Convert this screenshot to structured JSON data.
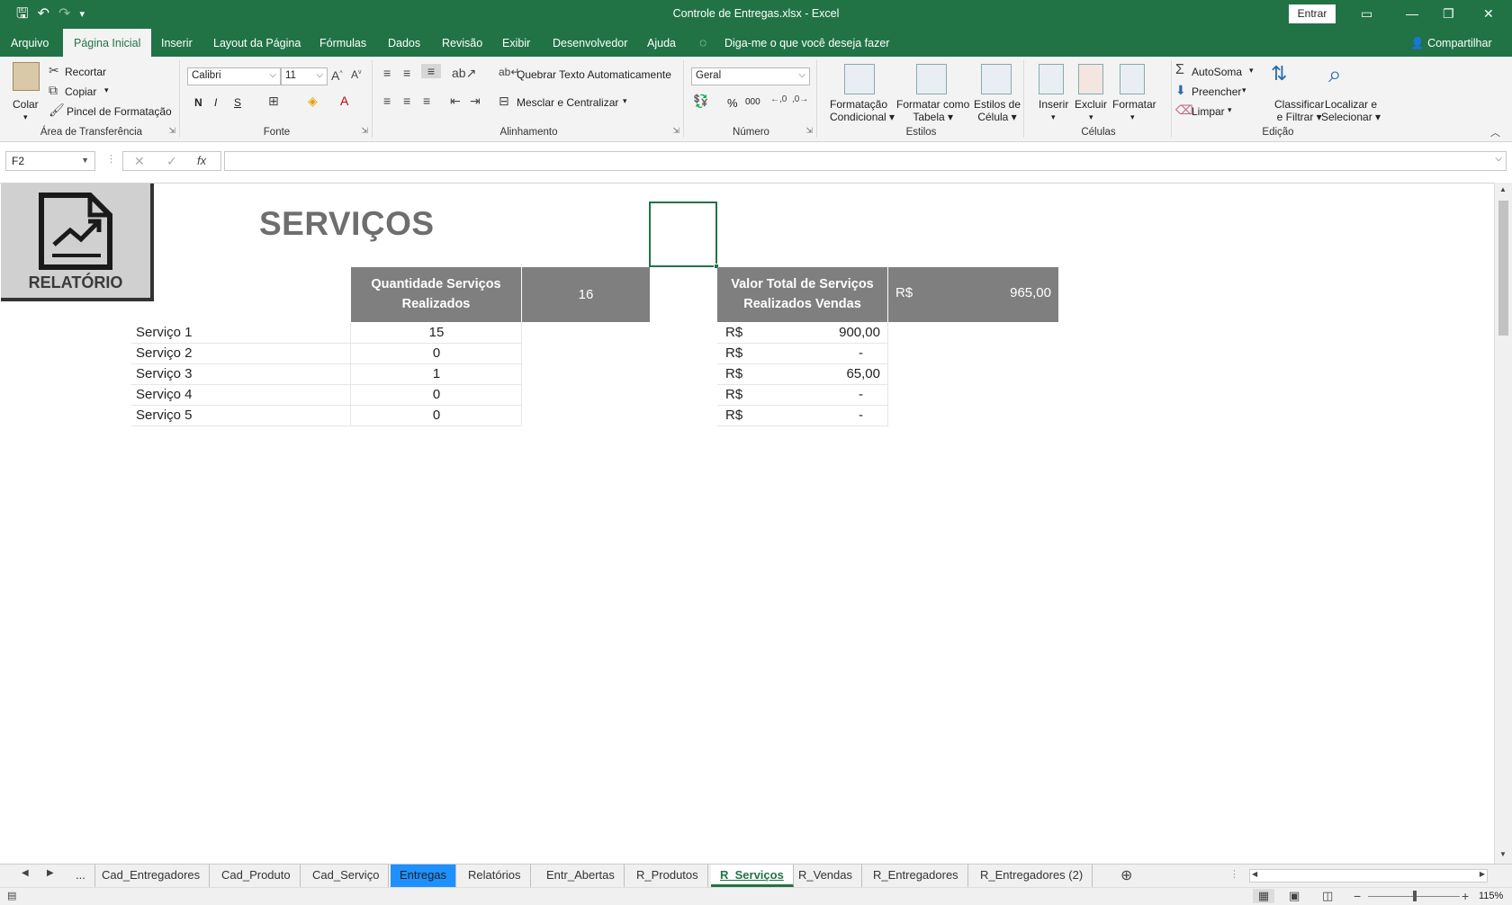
{
  "window": {
    "title": "Controle de Entregas.xlsx  -  Excel",
    "signin_label": "Entrar",
    "qat_icons": [
      "save-icon",
      "undo-icon",
      "redo-icon",
      "customize-icon"
    ]
  },
  "ribbon_tabs": [
    "Arquivo",
    "Página Inicial",
    "Inserir",
    "Layout da Página",
    "Fórmulas",
    "Dados",
    "Revisão",
    "Exibir",
    "Desenvolvedor",
    "Ajuda"
  ],
  "active_tab": "Página Inicial",
  "tell_me": "Diga-me o que você deseja fazer",
  "share_label": "Compartilhar",
  "clipboard": {
    "paste": "Colar",
    "cut": "Recortar",
    "copy": "Copiar",
    "format_painter": "Pincel de Formatação",
    "label": "Área de Transferência"
  },
  "font": {
    "name": "Calibri",
    "size": "11",
    "bold": "N",
    "italic": "I",
    "underline": "S",
    "label": "Fonte"
  },
  "alignment": {
    "wrap": "Quebrar Texto Automaticamente",
    "merge": "Mesclar e Centralizar",
    "label": "Alinhamento"
  },
  "number": {
    "format": "Geral",
    "label": "Número",
    "percent": "%",
    "thousands": "000"
  },
  "styles": {
    "conditional_1": "Formatação",
    "conditional_2": "Condicional",
    "table_1": "Formatar como",
    "table_2": "Tabela",
    "cell_1": "Estilos de",
    "cell_2": "Célula",
    "label": "Estilos"
  },
  "cells": {
    "insert": "Inserir",
    "delete": "Excluir",
    "format": "Formatar",
    "label": "Células"
  },
  "editing": {
    "autosum": "AutoSoma",
    "fill": "Preencher",
    "clear": "Limpar",
    "sort_1": "Classificar",
    "sort_2": "e Filtrar",
    "find_1": "Localizar e",
    "find_2": "Selecionar",
    "label": "Edição"
  },
  "formula_bar": {
    "name_box": "F2",
    "formula": "",
    "fx": "fx"
  },
  "sheet": {
    "logo_label": "RELATÓRIO",
    "title": "SERVIÇOS",
    "qty_header_1": "Quantidade Serviços",
    "qty_header_2": "Realizados",
    "qty_total": "16",
    "value_header_1": "Valor Total de Serviços",
    "value_header_2": "Realizados Vendas",
    "value_total_currency": "R$",
    "value_total": "965,00",
    "rows": [
      {
        "service": "Serviço 1",
        "qty": "15",
        "currency": "R$",
        "value": "900,00"
      },
      {
        "service": "Serviço 2",
        "qty": "0",
        "currency": "R$",
        "value": "-"
      },
      {
        "service": "Serviço 3",
        "qty": "1",
        "currency": "R$",
        "value": "65,00"
      },
      {
        "service": "Serviço 4",
        "qty": "0",
        "currency": "R$",
        "value": "-"
      },
      {
        "service": "Serviço 5",
        "qty": "0",
        "currency": "R$",
        "value": "-"
      }
    ]
  },
  "sheet_tabs": [
    "...",
    "Cad_Entregadores",
    "Cad_Produto",
    "Cad_Serviço",
    "Entregas",
    "Relatórios",
    "Entr_Abertas",
    "R_Produtos",
    "R_Serviços",
    "R_Vendas",
    "R_Entregadores",
    "R_Entregadores (2)"
  ],
  "active_sheet": "R_Serviços",
  "zoom": "115%",
  "colors": {
    "excel_green": "#217346",
    "header_gray": "#7f7f7f",
    "tab_blue": "#1e90ff"
  }
}
